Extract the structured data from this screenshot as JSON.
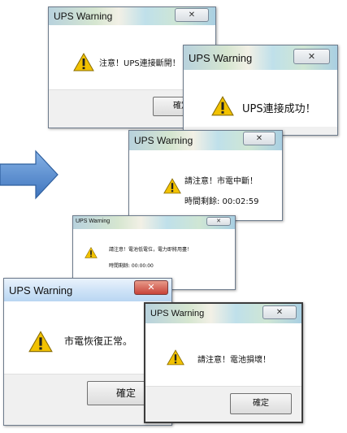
{
  "dialog_title": "UPS Warning",
  "close_symbol": "✕",
  "ok_label": "確定",
  "icons": {
    "arrow": "right-arrow-icon",
    "warning": "warning-triangle-icon"
  },
  "colors": {
    "arrow": "#5b8fd0",
    "warning": "#f2c200"
  },
  "dialogs": [
    {
      "message": "注意！UPS連接斷開！"
    },
    {
      "message": "UPS連接成功！"
    },
    {
      "message": "請注意！市電中斷！",
      "detail": "時間剩餘: 00:02:59"
    },
    {
      "message": "請注意！電池低電位，電力即將用盡！",
      "detail": "時間剩餘: 00:00:00"
    },
    {
      "message": "市電恢復正常。"
    },
    {
      "message": "請注意！電池損壞！"
    }
  ]
}
